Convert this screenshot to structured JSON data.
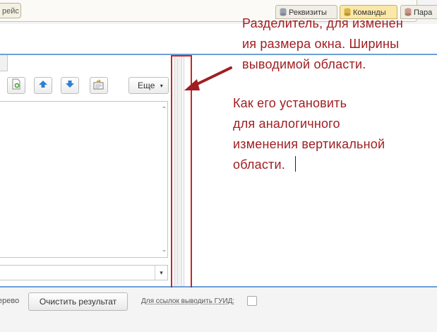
{
  "top": {
    "left_tab_fragment": "рейс",
    "tabs": [
      {
        "label": "Реквизиты",
        "active": false
      },
      {
        "label": "Команды",
        "active": true
      },
      {
        "label": "Пара",
        "active": false
      }
    ]
  },
  "toolbar": {
    "more_label": "Еще",
    "more_arrow": "▾"
  },
  "combo": {
    "arrow": "▾"
  },
  "bottom": {
    "tree_label_fragment": "ерево",
    "clear_button": "Очистить результат",
    "guid_label": "Для ссылок выводить ГУИД:"
  },
  "annotations": {
    "note1": "Разделитель, для изменен\nия размера окна. Ширины\nвыводимой области.",
    "note2": "Как его установить\nдля аналогичного\nизменения вертикальной\nобласти."
  },
  "colors": {
    "annotation": "#a01e22",
    "highlight_box": "#c8262a",
    "accent_blue": "#6e9fd7",
    "active_tab": "#fbe8a8"
  },
  "icons": [
    "database-icon",
    "add-doc-icon",
    "arrow-up-icon",
    "arrow-down-icon",
    "settings-doc-icon",
    "chevron-down-icon",
    "arrow-annotation-icon"
  ]
}
